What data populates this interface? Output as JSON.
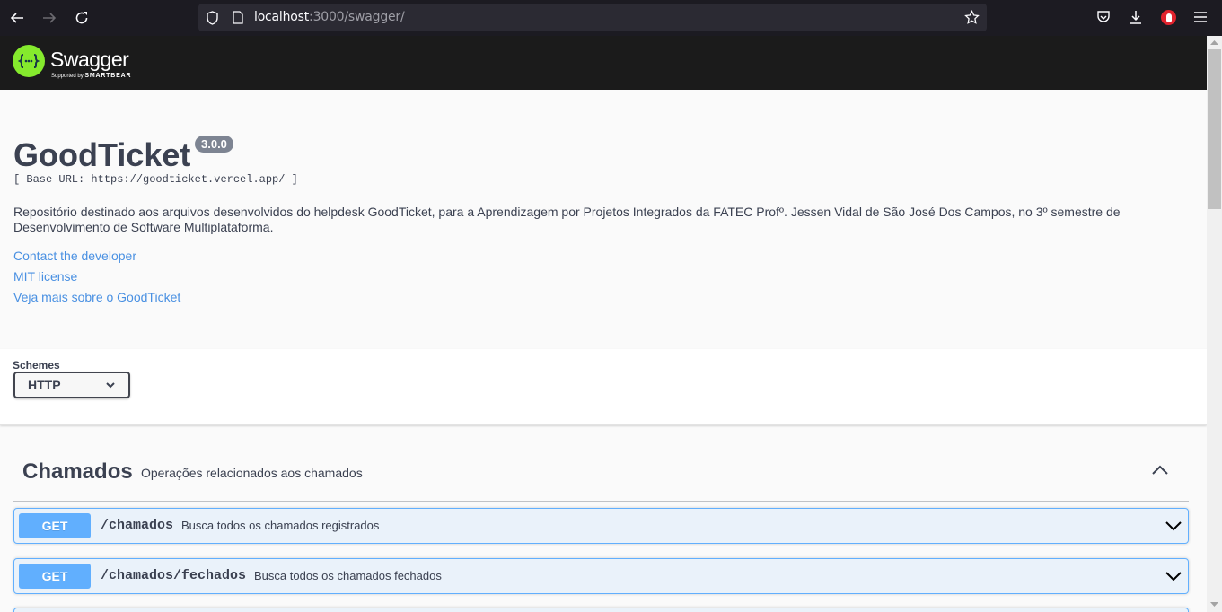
{
  "browser": {
    "url_host": "localhost",
    "url_rest": ":3000/swagger/"
  },
  "swagger": {
    "brand": "Swagger",
    "supported_by": "Supported by",
    "smartbear": "SMARTBEAR"
  },
  "info": {
    "title": "GoodTicket",
    "version": "3.0.0",
    "base_url": "[ Base URL: https://goodticket.vercel.app/ ]",
    "description": "Repositório destinado aos arquivos desenvolvidos do helpdesk GoodTicket, para a Aprendizagem por Projetos Integrados da FATEC Profº. Jessen Vidal de São José Dos Campos, no 3º semestre de Desenvolvimento de Software Multiplataforma.",
    "links": {
      "contact": "Contact the developer",
      "license": "MIT license",
      "more": "Veja mais sobre o GoodTicket"
    }
  },
  "schemes": {
    "label": "Schemes",
    "selected": "HTTP"
  },
  "tag": {
    "name": "Chamados",
    "description": "Operações relacionados aos chamados"
  },
  "operations": [
    {
      "method": "GET",
      "path": "/chamados",
      "summary": "Busca todos os chamados registrados"
    },
    {
      "method": "GET",
      "path": "/chamados/fechados",
      "summary": "Busca todos os chamados fechados"
    }
  ],
  "colors": {
    "get": "#61affe",
    "text": "#3b4151",
    "link": "#4990e2",
    "swagger_green": "#85ea2d"
  }
}
